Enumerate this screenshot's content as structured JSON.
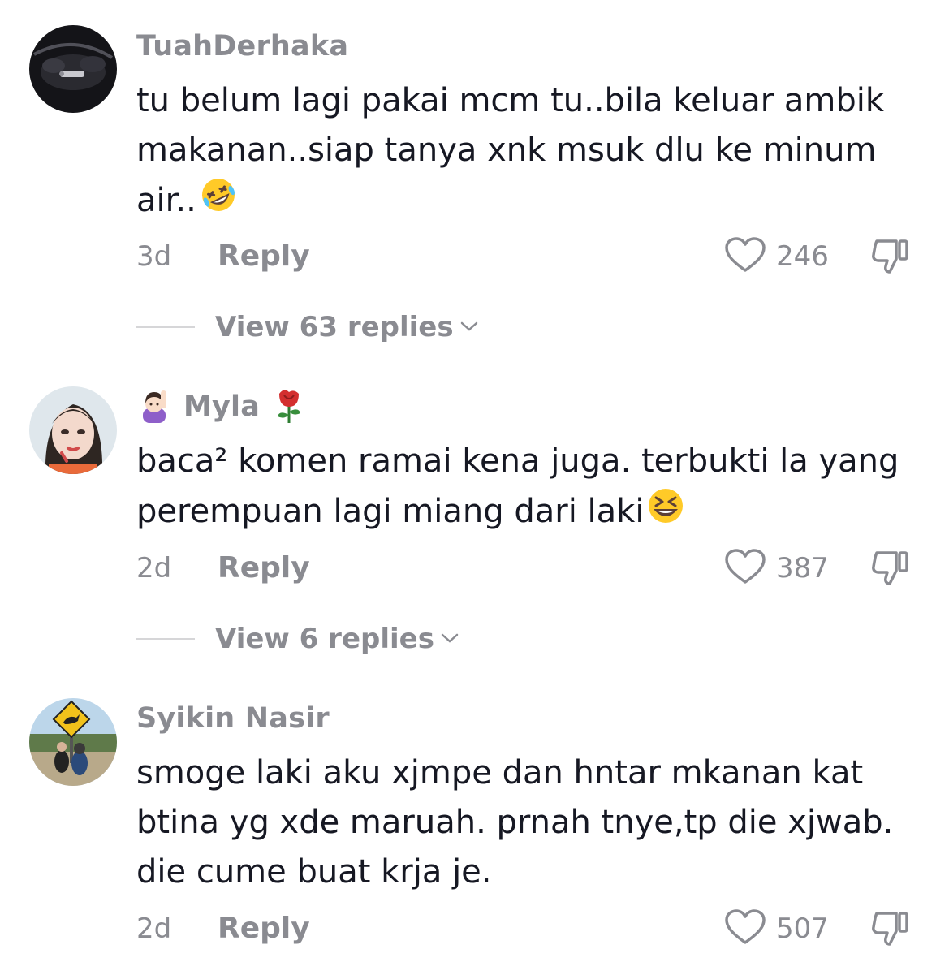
{
  "comments": [
    {
      "username": "TuahDerhaka",
      "text": "tu belum lagi pakai mcm tu..bila keluar ambik makanan..siap tanya xnk msuk dlu ke minum air..",
      "time": "3d",
      "reply_label": "Reply",
      "likes": "246",
      "view_replies": "View 63 replies"
    },
    {
      "username": "Myla",
      "text": "baca² komen ramai kena juga. terbukti la yang perempuan lagi miang dari laki",
      "time": "2d",
      "reply_label": "Reply",
      "likes": "387",
      "view_replies": "View 6 replies"
    },
    {
      "username": "Syikin Nasir",
      "text": "smoge laki aku xjmpe dan hntar mkanan kat btina yg xde maruah. prnah tnye,tp die xjwab. die cume buat krja je.",
      "time": "2d",
      "reply_label": "Reply",
      "likes": "507"
    }
  ],
  "colors": {
    "text": "#161823",
    "secondary": "#8a8b91",
    "divider": "#d6d6d8"
  },
  "icons": [
    "heart-outline-icon",
    "thumbs-down-icon",
    "chevron-down-icon",
    "rofl-emoji",
    "woman-raising-hand-emoji",
    "rose-emoji",
    "grinning-squinting-emoji"
  ]
}
